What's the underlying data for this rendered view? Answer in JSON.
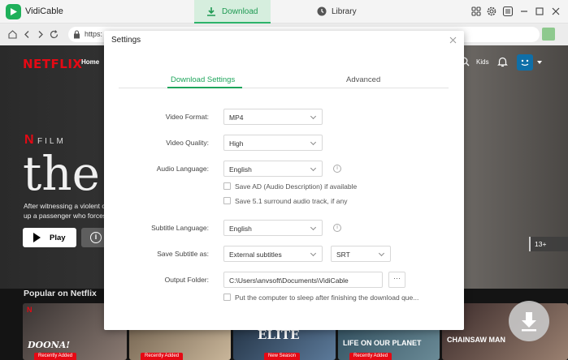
{
  "app": {
    "title": "VidiCable"
  },
  "tabs": {
    "download": "Download",
    "library": "Library"
  },
  "address": {
    "url": "https:"
  },
  "netflix": {
    "logo": "NETFLIX",
    "nav_home": "Home",
    "kids": "Kids",
    "film_badge": "FILM",
    "film_n": "N",
    "hero_title": "the",
    "desc_line1": "After witnessing a violent c",
    "desc_line2": "up a passenger who forces",
    "play_label": "Play",
    "info_symbol": "i",
    "age_rating": "13+",
    "popular_heading": "Popular on Netflix",
    "thumbnails": [
      {
        "title": "DOONA!",
        "badge": "Recently Added"
      },
      {
        "title": "",
        "badge": "Recently Added"
      },
      {
        "title": "ELITE",
        "badge": "New Season"
      },
      {
        "title": "LIFE ON OUR PLANET",
        "badge": "Recently Added"
      },
      {
        "title": "CHAINSAW MAN",
        "badge": ""
      }
    ]
  },
  "settings": {
    "title": "Settings",
    "tab_download_settings": "Download Settings",
    "tab_advanced": "Advanced",
    "video_format_label": "Video Format:",
    "video_format_value": "MP4",
    "video_quality_label": "Video Quality:",
    "video_quality_value": "High",
    "audio_language_label": "Audio Language:",
    "audio_language_value": "English",
    "save_ad_label": "Save AD (Audio Description) if available",
    "save_51_label": "Save 5.1 surround audio track, if any",
    "subtitle_language_label": "Subtitle Language:",
    "subtitle_language_value": "English",
    "save_subtitle_label": "Save Subtitle as:",
    "save_subtitle_value": "External subtitles",
    "subtitle_format_value": "SRT",
    "output_folder_label": "Output Folder:",
    "output_folder_value": "C:\\Users\\anvsoft\\Documents\\VidiCable",
    "browse_label": "···",
    "sleep_label": "Put the computer to sleep after finishing the download que..."
  },
  "colors": {
    "accent": "#1ea55b",
    "netflix_red": "#e50914"
  }
}
